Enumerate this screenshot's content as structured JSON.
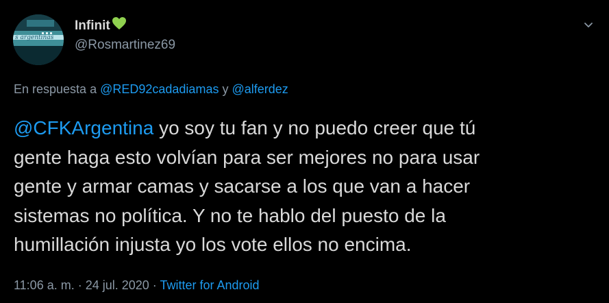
{
  "user": {
    "display_name": "Infinit",
    "emoji_icon": "green-heart-icon",
    "handle": "@Rosmartinez69",
    "avatar_icon": "airplane-photo-avatar"
  },
  "menu": {
    "icon": "chevron-down-icon"
  },
  "reply": {
    "prefix": "En respuesta a ",
    "user1": "@RED92cadadiamas",
    "joiner": " y ",
    "user2": "@alferdez"
  },
  "tweet": {
    "mention": "@CFKArgentina",
    "text": "  yo soy tu fan y no puedo creer que tú\ngente haga esto volvían para ser mejores no para usar\ngente y armar camas y sacarse a los que van a hacer\nsistemas no política. Y no te hablo del puesto de la\nhumillación injusta yo los vote ellos no encima."
  },
  "meta": {
    "time": "11:06 a. m.",
    "sep1": " · ",
    "date": "24 jul. 2020",
    "sep2": " · ",
    "source": "Twitter for Android"
  },
  "colors": {
    "background": "#000000",
    "text": "#d9d9d9",
    "muted": "#8b98a5",
    "link": "#1d9bf0",
    "heart": "#8fd14f"
  }
}
